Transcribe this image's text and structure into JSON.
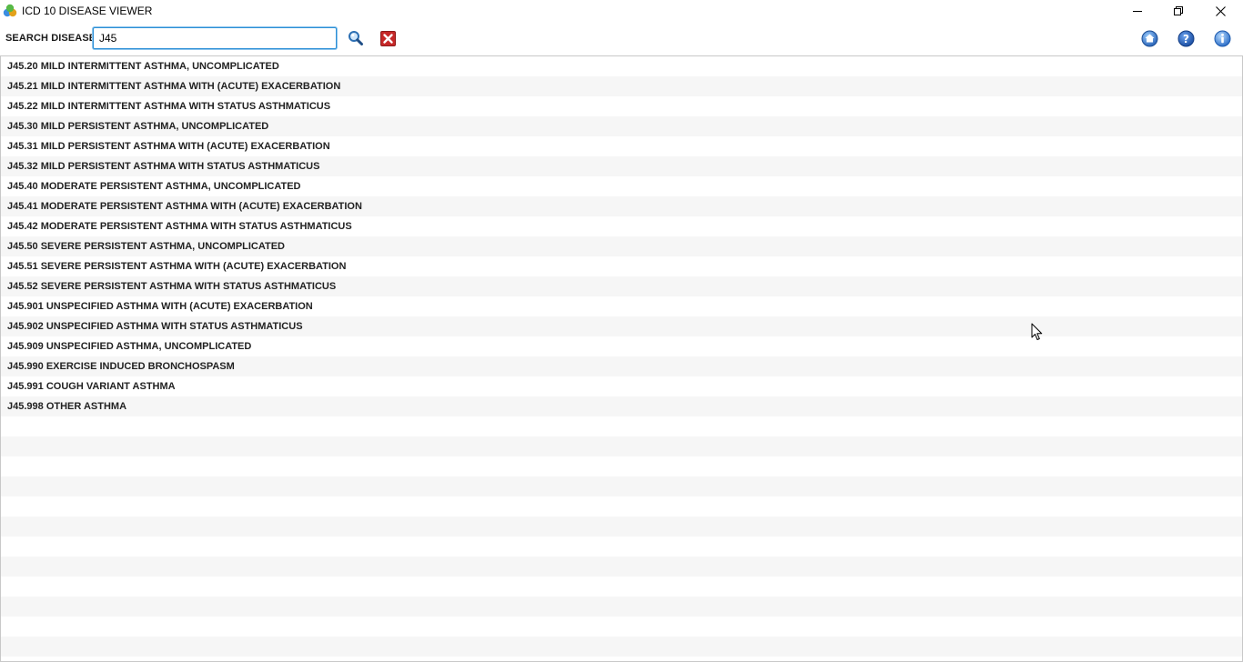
{
  "window": {
    "title": "ICD 10 DISEASE VIEWER",
    "controls": [
      "minimize-icon",
      "restore-icon",
      "close-icon"
    ]
  },
  "toolbar": {
    "search_label": "SEARCH DISEASES",
    "search_value": "J45",
    "buttons": [
      "search-icon",
      "clear-icon",
      "home-icon",
      "help-icon",
      "info-icon"
    ]
  },
  "colors": {
    "input_focus_border": "#2b8fd6",
    "clear_button": "#c62828",
    "round_buttons": "#2f6fc4",
    "alt_row": "#f6f6f6"
  },
  "results": [
    "J45.20 MILD INTERMITTENT ASTHMA, UNCOMPLICATED",
    "J45.21 MILD INTERMITTENT ASTHMA WITH (ACUTE) EXACERBATION",
    "J45.22 MILD INTERMITTENT ASTHMA WITH STATUS ASTHMATICUS",
    "J45.30 MILD PERSISTENT ASTHMA, UNCOMPLICATED",
    "J45.31 MILD PERSISTENT ASTHMA WITH (ACUTE) EXACERBATION",
    "J45.32 MILD PERSISTENT ASTHMA WITH STATUS ASTHMATICUS",
    "J45.40 MODERATE PERSISTENT ASTHMA, UNCOMPLICATED",
    "J45.41 MODERATE PERSISTENT ASTHMA WITH (ACUTE) EXACERBATION",
    "J45.42 MODERATE PERSISTENT ASTHMA WITH STATUS ASTHMATICUS",
    "J45.50 SEVERE PERSISTENT ASTHMA, UNCOMPLICATED",
    "J45.51 SEVERE PERSISTENT ASTHMA WITH (ACUTE) EXACERBATION",
    "J45.52 SEVERE PERSISTENT ASTHMA WITH STATUS ASTHMATICUS",
    "J45.901 UNSPECIFIED ASTHMA WITH (ACUTE) EXACERBATION",
    "J45.902 UNSPECIFIED ASTHMA WITH STATUS ASTHMATICUS",
    "J45.909 UNSPECIFIED ASTHMA, UNCOMPLICATED",
    "J45.990 EXERCISE INDUCED BRONCHOSPASM",
    "J45.991 COUGH VARIANT ASTHMA",
    "J45.998 OTHER ASTHMA"
  ]
}
